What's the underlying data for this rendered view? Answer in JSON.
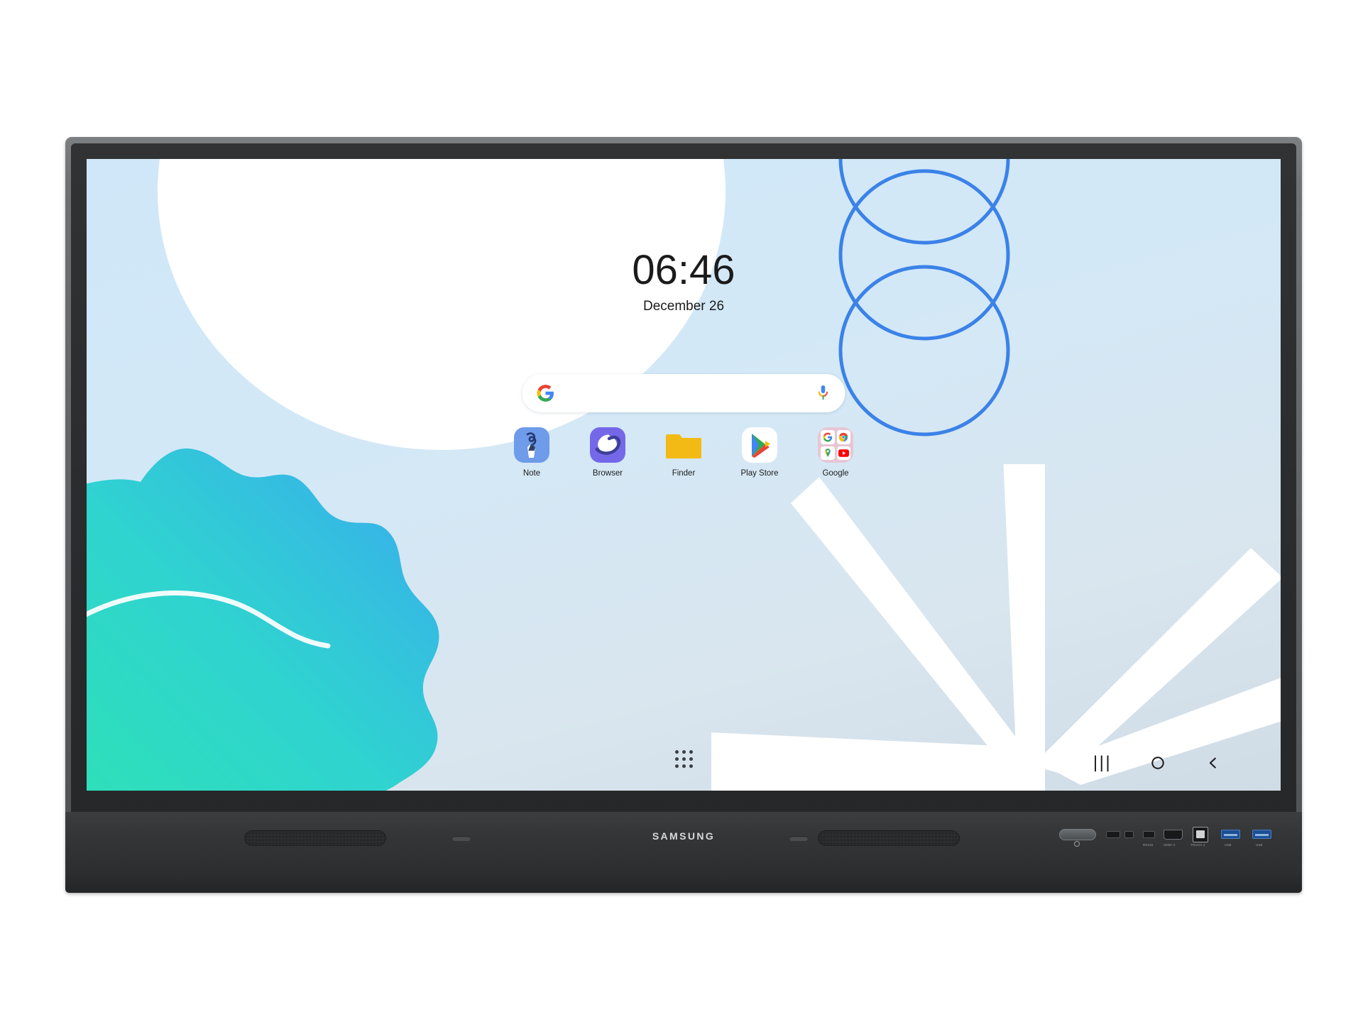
{
  "device": {
    "brand": "SAMSUNG",
    "type": "interactive-display",
    "ports": [
      {
        "name": "power-button",
        "label": ""
      },
      {
        "name": "slot-port-1",
        "label": ""
      },
      {
        "name": "slot-port-2",
        "label": ""
      },
      {
        "name": "slot-port-3",
        "label": "RS232"
      },
      {
        "name": "hdmi-port",
        "label": "HDMI 3"
      },
      {
        "name": "touch-port",
        "label": "TOUCH 2"
      },
      {
        "name": "usb-port-1",
        "label": "USB"
      },
      {
        "name": "usb-port-2",
        "label": "USB"
      }
    ]
  },
  "clock": {
    "time": "06:46",
    "date": "December 26"
  },
  "search": {
    "placeholder": "",
    "value": "",
    "google_icon": "google-g-icon",
    "mic_icon": "microphone-icon"
  },
  "apps": [
    {
      "label": "Note",
      "icon": "note-pen-icon"
    },
    {
      "label": "Browser",
      "icon": "samsung-internet-icon"
    },
    {
      "label": "Finder",
      "icon": "folder-icon"
    },
    {
      "label": "Play Store",
      "icon": "play-store-icon"
    },
    {
      "label": "Google",
      "icon": "google-folder-icon"
    }
  ],
  "folder": {
    "items": [
      "Google",
      "Chrome",
      "Maps",
      "YouTube"
    ]
  },
  "navigation": {
    "app_drawer": "apps-grid-icon",
    "recents": "|||",
    "home": "home-circle-icon",
    "back": "back-chevron-icon"
  },
  "colors": {
    "wallpaper_top": "#cfe7f8",
    "wallpaper_bottom": "#cfdbe5",
    "circle_outline": "#3b82e8",
    "blob_start": "#2ee0b8",
    "blob_end": "#3aa9f0",
    "bezel": "#2b2d2f",
    "accent_white": "#ffffff"
  }
}
